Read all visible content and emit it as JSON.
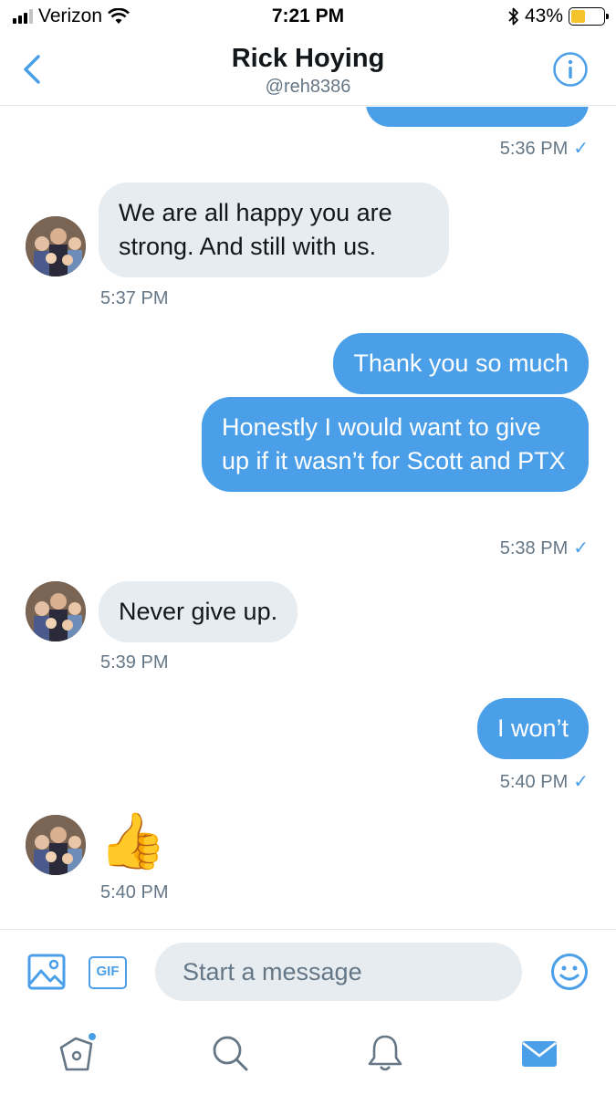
{
  "status_bar": {
    "carrier": "Verizon",
    "time": "7:21 PM",
    "battery": "43%"
  },
  "header": {
    "title": "Rick Hoying",
    "handle": "@reh8386"
  },
  "messages": [
    {
      "text": "",
      "time": "5:36 PM",
      "check": "✓"
    },
    {
      "text": "We are all happy you are strong. And still with us.",
      "time": "5:37 PM"
    },
    {
      "text": "Thank you so much"
    },
    {
      "text": "Honestly I would want to give up if it wasn’t for Scott and PTX",
      "time": "5:38 PM",
      "check": "✓"
    },
    {
      "text": "Never give up.",
      "time": "5:39 PM"
    },
    {
      "text": "I won’t",
      "time": "5:40 PM",
      "check": "✓"
    },
    {
      "text": "👍",
      "time": "5:40 PM"
    }
  ],
  "composer": {
    "placeholder": "Start a message",
    "gif_label": "GIF"
  },
  "colors": {
    "accent": "#4a9fe8",
    "incoming_bubble": "#e6ecf0",
    "muted": "#657786"
  },
  "icons": {
    "back": "chevron-left-icon",
    "info": "info-icon",
    "media": "image-icon",
    "gif": "gif-icon",
    "emoji": "emoji-icon",
    "home": "home-icon",
    "search": "search-icon",
    "notifications": "bell-icon",
    "messages": "mail-icon"
  }
}
